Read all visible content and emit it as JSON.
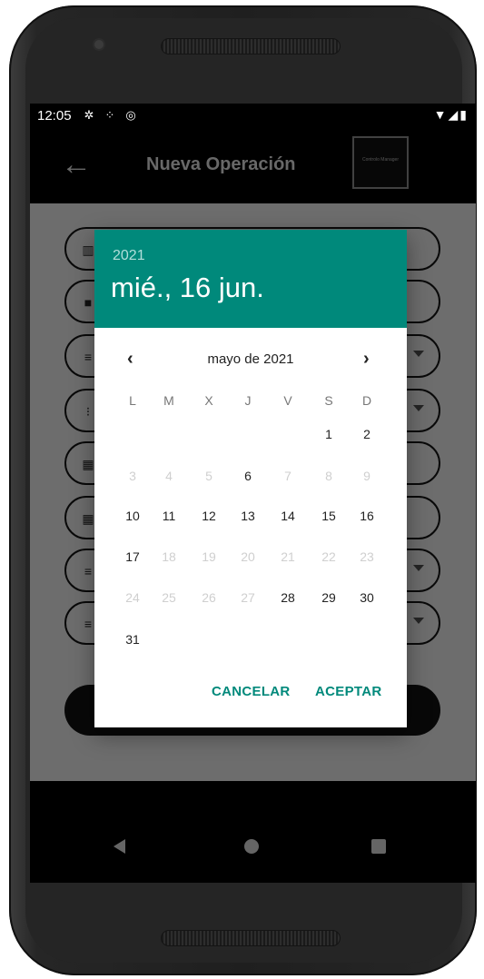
{
  "status_bar": {
    "time": "12:05",
    "icons": [
      "gear-icon",
      "dots-icon",
      "sync-icon"
    ],
    "right_icons": [
      "wifi-icon",
      "signal-icon",
      "battery-icon"
    ]
  },
  "header": {
    "back_icon": "arrow-left-icon",
    "title": "Nueva Operación",
    "logo_text": "Controlo Manager"
  },
  "date_picker": {
    "year": "2021",
    "selected_date": "mié., 16 jun.",
    "month_title": "mayo de 2021",
    "weekdays": [
      "L",
      "M",
      "X",
      "J",
      "V",
      "S",
      "D"
    ],
    "weeks": [
      [
        null,
        null,
        null,
        null,
        null,
        {
          "d": "1",
          "enabled": true
        },
        {
          "d": "2",
          "enabled": true
        }
      ],
      [
        {
          "d": "3",
          "enabled": false
        },
        {
          "d": "4",
          "enabled": false
        },
        {
          "d": "5",
          "enabled": false
        },
        {
          "d": "6",
          "enabled": true
        },
        {
          "d": "7",
          "enabled": false
        },
        {
          "d": "8",
          "enabled": false
        },
        {
          "d": "9",
          "enabled": false
        }
      ],
      [
        {
          "d": "10",
          "enabled": true
        },
        {
          "d": "11",
          "enabled": true
        },
        {
          "d": "12",
          "enabled": true
        },
        {
          "d": "13",
          "enabled": true
        },
        {
          "d": "14",
          "enabled": true
        },
        {
          "d": "15",
          "enabled": true
        },
        {
          "d": "16",
          "enabled": true
        }
      ],
      [
        {
          "d": "17",
          "enabled": true
        },
        {
          "d": "18",
          "enabled": false
        },
        {
          "d": "19",
          "enabled": false
        },
        {
          "d": "20",
          "enabled": false
        },
        {
          "d": "21",
          "enabled": false
        },
        {
          "d": "22",
          "enabled": false
        },
        {
          "d": "23",
          "enabled": false
        }
      ],
      [
        {
          "d": "24",
          "enabled": false
        },
        {
          "d": "25",
          "enabled": false
        },
        {
          "d": "26",
          "enabled": false
        },
        {
          "d": "27",
          "enabled": false
        },
        {
          "d": "28",
          "enabled": true
        },
        {
          "d": "29",
          "enabled": true
        },
        {
          "d": "30",
          "enabled": true
        }
      ],
      [
        {
          "d": "31",
          "enabled": true
        },
        null,
        null,
        null,
        null,
        null,
        null
      ]
    ],
    "cancel_label": "CANCELAR",
    "ok_label": "ACEPTAR"
  },
  "colors": {
    "accent": "#00897b",
    "header_bg": "#000000"
  }
}
